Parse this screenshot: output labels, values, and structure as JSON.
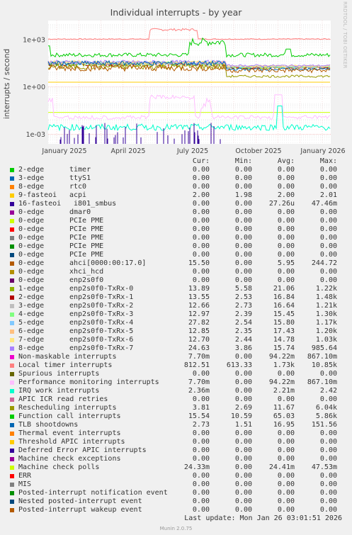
{
  "title": "Individual interrupts - by year",
  "y_axis_label": "interrupts / second",
  "watermark": "RRDTOOL / TOBI OETIKER",
  "columns": [
    "Cur:",
    "Min:",
    "Avg:",
    "Max:"
  ],
  "last_update": "Last update: Mon Jan 26 03:01:51 2026",
  "footer": "Munin 2.0.75",
  "chart_data": {
    "type": "line",
    "title": "Individual interrupts - by year",
    "ylabel": "interrupts / second",
    "yscale": "log",
    "y_ticks": [
      "1e-03",
      "1e+00",
      "1e+03"
    ],
    "x_ticks": [
      "January 2025",
      "April 2025",
      "July 2025",
      "October 2025",
      "January 2026"
    ],
    "grid": true,
    "legend_placement": "bottom",
    "series": [
      {
        "name": "2-edge",
        "label": "timer",
        "color": "#00cc00",
        "cur": "0.00",
        "min": "0.00",
        "avg": "0.00",
        "max": "0.00"
      },
      {
        "name": "3-edge",
        "label": "ttyS1",
        "color": "#0066b3",
        "cur": "0.00",
        "min": "0.00",
        "avg": "0.00",
        "max": "0.00"
      },
      {
        "name": "8-edge",
        "label": "rtc0",
        "color": "#ff8000",
        "cur": "0.00",
        "min": "0.00",
        "avg": "0.00",
        "max": "0.00"
      },
      {
        "name": "9-fasteoi",
        "label": "acpi",
        "color": "#ffcc00",
        "cur": "2.00",
        "min": "1.98",
        "avg": "2.00",
        "max": "2.01"
      },
      {
        "name": "16-fasteoi",
        "label": "i801_smbus",
        "color": "#330099",
        "cur": "0.00",
        "min": "0.00",
        "avg": "27.26u",
        "max": "47.46m"
      },
      {
        "name": "0-edge",
        "label": "dmar0",
        "color": "#990099",
        "cur": "0.00",
        "min": "0.00",
        "avg": "0.00",
        "max": "0.00"
      },
      {
        "name": "0-edge",
        "label": "PCIe PME",
        "color": "#ccff00",
        "cur": "0.00",
        "min": "0.00",
        "avg": "0.00",
        "max": "0.00"
      },
      {
        "name": "0-edge",
        "label": "PCIe PME",
        "color": "#ff0000",
        "cur": "0.00",
        "min": "0.00",
        "avg": "0.00",
        "max": "0.00"
      },
      {
        "name": "0-edge",
        "label": "PCIe PME",
        "color": "#808080",
        "cur": "0.00",
        "min": "0.00",
        "avg": "0.00",
        "max": "0.00"
      },
      {
        "name": "0-edge",
        "label": "PCIe PME",
        "color": "#008f00",
        "cur": "0.00",
        "min": "0.00",
        "avg": "0.00",
        "max": "0.00"
      },
      {
        "name": "0-edge",
        "label": "PCIe PME",
        "color": "#00487d",
        "cur": "0.00",
        "min": "0.00",
        "avg": "0.00",
        "max": "0.00"
      },
      {
        "name": "0-edge",
        "label": "ahci[0000:00:17.0]",
        "color": "#b35a00",
        "cur": "15.50",
        "min": "0.00",
        "avg": "5.95",
        "max": "244.72"
      },
      {
        "name": "0-edge",
        "label": "xhci_hcd",
        "color": "#b38f00",
        "cur": "0.00",
        "min": "0.00",
        "avg": "0.00",
        "max": "0.00"
      },
      {
        "name": "0-edge",
        "label": "enp2s0f0",
        "color": "#6b006b",
        "cur": "0.00",
        "min": "0.00",
        "avg": "0.00",
        "max": "0.00"
      },
      {
        "name": "1-edge",
        "label": "enp2s0f0-TxRx-0",
        "color": "#8fb300",
        "cur": "13.89",
        "min": "5.58",
        "avg": "21.06",
        "max": "1.22k"
      },
      {
        "name": "2-edge",
        "label": "enp2s0f0-TxRx-1",
        "color": "#b30000",
        "cur": "13.55",
        "min": "2.53",
        "avg": "16.84",
        "max": "1.48k"
      },
      {
        "name": "3-edge",
        "label": "enp2s0f0-TxRx-2",
        "color": "#bebebe",
        "cur": "12.66",
        "min": "2.73",
        "avg": "16.64",
        "max": "1.21k"
      },
      {
        "name": "4-edge",
        "label": "enp2s0f0-TxRx-3",
        "color": "#80ff80",
        "cur": "12.97",
        "min": "2.39",
        "avg": "15.45",
        "max": "1.30k"
      },
      {
        "name": "5-edge",
        "label": "enp2s0f0-TxRx-4",
        "color": "#80c9ff",
        "cur": "27.82",
        "min": "2.54",
        "avg": "15.80",
        "max": "1.17k"
      },
      {
        "name": "6-edge",
        "label": "enp2s0f0-TxRx-5",
        "color": "#ffc080",
        "cur": "12.85",
        "min": "2.35",
        "avg": "17.43",
        "max": "1.20k"
      },
      {
        "name": "7-edge",
        "label": "enp2s0f0-TxRx-6",
        "color": "#ffe680",
        "cur": "12.70",
        "min": "2.44",
        "avg": "14.78",
        "max": "1.03k"
      },
      {
        "name": "8-edge",
        "label": "enp2s0f0-TxRx-7",
        "color": "#aa80ff",
        "cur": "24.63",
        "min": "3.86",
        "avg": "15.74",
        "max": "985.64"
      },
      {
        "name": "Non-maskable interrupts",
        "label": "",
        "color": "#ee00cc",
        "cur": "7.70m",
        "min": "0.00",
        "avg": "94.22m",
        "max": "867.10m"
      },
      {
        "name": "Local timer interrupts",
        "label": "",
        "color": "#ff8080",
        "cur": "812.51",
        "min": "613.33",
        "avg": "1.73k",
        "max": "10.85k"
      },
      {
        "name": "Spurious interrupts",
        "label": "",
        "color": "#666600",
        "cur": "0.00",
        "min": "0.00",
        "avg": "0.00",
        "max": "0.00"
      },
      {
        "name": "Performance monitoring interrupts",
        "label": "",
        "color": "#ffbfff",
        "cur": "7.70m",
        "min": "0.00",
        "avg": "94.22m",
        "max": "867.10m"
      },
      {
        "name": "IRQ work interrupts",
        "label": "",
        "color": "#00ffcc",
        "cur": "2.36m",
        "min": "0.00",
        "avg": "2.21m",
        "max": "2.42"
      },
      {
        "name": "APIC ICR read retries",
        "label": "",
        "color": "#cc6699",
        "cur": "0.00",
        "min": "0.00",
        "avg": "0.00",
        "max": "0.00"
      },
      {
        "name": "Rescheduling interrupts",
        "label": "",
        "color": "#999900",
        "cur": "3.81",
        "min": "2.69",
        "avg": "11.67",
        "max": "6.04k"
      },
      {
        "name": "Function call interrupts",
        "label": "",
        "color": "#00cc00",
        "cur": "15.54",
        "min": "10.59",
        "avg": "65.03",
        "max": "5.86k"
      },
      {
        "name": "TLB shootdowns",
        "label": "",
        "color": "#0066b3",
        "cur": "2.73",
        "min": "1.51",
        "avg": "16.95",
        "max": "151.56"
      },
      {
        "name": "Thermal event interrupts",
        "label": "",
        "color": "#ff8000",
        "cur": "0.00",
        "min": "0.00",
        "avg": "0.00",
        "max": "0.00"
      },
      {
        "name": "Threshold APIC interrupts",
        "label": "",
        "color": "#ffcc00",
        "cur": "0.00",
        "min": "0.00",
        "avg": "0.00",
        "max": "0.00"
      },
      {
        "name": "Deferred Error APIC interrupts",
        "label": "",
        "color": "#330099",
        "cur": "0.00",
        "min": "0.00",
        "avg": "0.00",
        "max": "0.00"
      },
      {
        "name": "Machine check exceptions",
        "label": "",
        "color": "#990099",
        "cur": "0.00",
        "min": "0.00",
        "avg": "0.00",
        "max": "0.00"
      },
      {
        "name": "Machine check polls",
        "label": "",
        "color": "#ccff00",
        "cur": "24.33m",
        "min": "0.00",
        "avg": "24.41m",
        "max": "47.53m"
      },
      {
        "name": "ERR",
        "label": "",
        "color": "#ff0000",
        "cur": "0.00",
        "min": "0.00",
        "avg": "0.00",
        "max": "0.00"
      },
      {
        "name": "MIS",
        "label": "",
        "color": "#808080",
        "cur": "0.00",
        "min": "0.00",
        "avg": "0.00",
        "max": "0.00"
      },
      {
        "name": "Posted-interrupt notification event",
        "label": "",
        "color": "#008f00",
        "cur": "0.00",
        "min": "0.00",
        "avg": "0.00",
        "max": "0.00"
      },
      {
        "name": "Nested posted-interrupt event",
        "label": "",
        "color": "#00487d",
        "cur": "0.00",
        "min": "0.00",
        "avg": "0.00",
        "max": "0.00"
      },
      {
        "name": "Posted-interrupt wakeup event",
        "label": "",
        "color": "#b35a00",
        "cur": "0.00",
        "min": "0.00",
        "avg": "0.00",
        "max": "0.00"
      }
    ]
  }
}
